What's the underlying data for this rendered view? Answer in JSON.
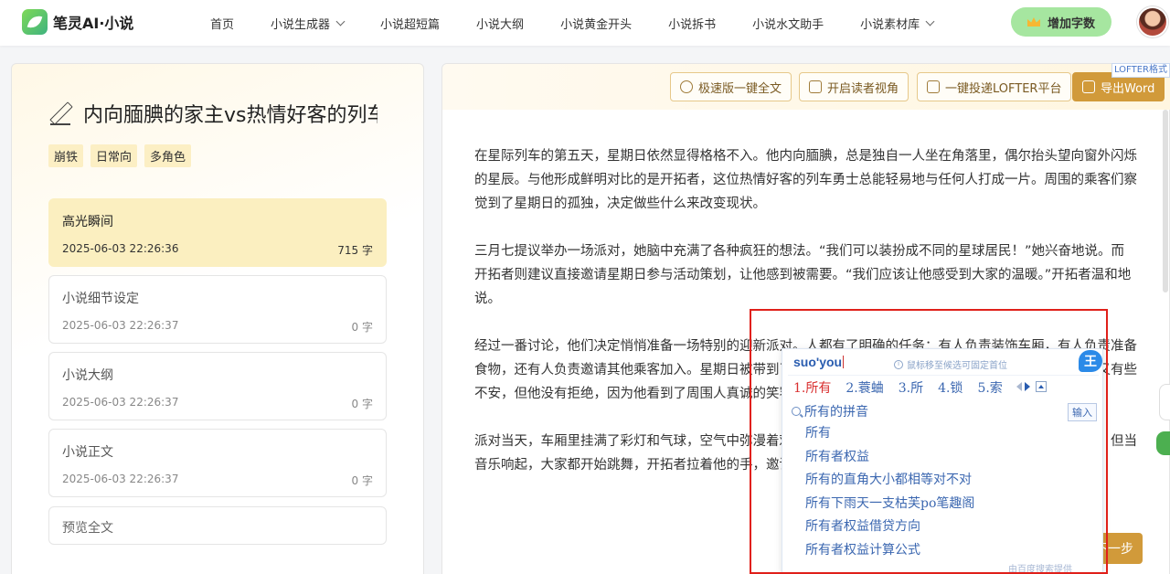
{
  "header": {
    "logo_text": "笔灵AI·小说",
    "nav": [
      {
        "label": "首页",
        "has_dropdown": false
      },
      {
        "label": "小说生成器",
        "has_dropdown": true
      },
      {
        "label": "小说超短篇",
        "has_dropdown": false
      },
      {
        "label": "小说大纲",
        "has_dropdown": false
      },
      {
        "label": "小说黄金开头",
        "has_dropdown": false
      },
      {
        "label": "小说拆书",
        "has_dropdown": false
      },
      {
        "label": "小说水文助手",
        "has_dropdown": false
      },
      {
        "label": "小说素材库",
        "has_dropdown": true
      }
    ],
    "add_words_label": "增加字数"
  },
  "left": {
    "title": "内向腼腆的家主vs热情好客的列车",
    "tags": [
      "崩铁",
      "日常向",
      "多角色"
    ],
    "cards": [
      {
        "title": "高光瞬间",
        "time": "2025-06-03 22:26:36",
        "count": "715 字",
        "active": true
      },
      {
        "title": "小说细节设定",
        "time": "2025-06-03 22:26:37",
        "count": "0 字",
        "active": false
      },
      {
        "title": "小说大纲",
        "time": "2025-06-03 22:26:37",
        "count": "0 字",
        "active": false
      },
      {
        "title": "小说正文",
        "time": "2025-06-03 22:26:37",
        "count": "0 字",
        "active": false
      }
    ],
    "preview_label": "预览全文"
  },
  "toolbar": {
    "fast_full": "极速版一键全文",
    "reader_view": "开启读者视角",
    "lofter": "一键投递LOFTER平台",
    "export_word": "导出Word",
    "lofter_badge": "LOFTER格式"
  },
  "story": {
    "paragraphs": [
      "在星际列车的第五天，星期日依然显得格格不入。他内向腼腆，总是独自一人坐在角落里，偶尔抬头望向窗外闪烁的星辰。与他形成鲜明对比的是开拓者，这位热情好客的列车勇士总能轻易地与任何人打成一片。周围的乘客们察觉到了星期日的孤独，决定做些什么来改变现状。",
      "三月七提议举办一场派对，她脑中充满了各种疯狂的想法。“我们可以装扮成不同的星球居民！”她兴奋地说。而开拓者则建议直接邀请星期日参与活动策划，让他感到被需要。“我们应该让他感受到大家的温暖。”开拓者温和地说。",
      "经过一番讨论，他们决定悄悄准备一场特别的迎新派对。人都有了明确的任务：有人负责装饰车厢，有人负责准备食物，还有人负责邀请其他乘客加入。星期日被带到了车厢中央，看到大家为他精心准备的一切，他既陌生又有些不安，但他没有拒绝，因为他看到了周围人真诚的笑容。",
      "派对当天，车厢里挂满了彩灯和气球，空气中弥漫着欢快的气息。星期日站在人群之中，脸上带着一丝紧张。但当音乐响起，大家都开始跳舞，开拓者拉着他的手，邀请他一起加入欢乐的人群，一起开拓"
    ]
  },
  "ime": {
    "pinyin": "suo'you",
    "hint": "鼠标移至候选可固定首位",
    "candidates": [
      "1.所有",
      "2.蓑蛐",
      "3.所",
      "4.锁",
      "5.索"
    ],
    "search_label": "所有的拼音",
    "input_button": "输入",
    "suggestions": [
      "所有",
      "所有者权益",
      "所有的直角大小都相等对不对",
      "所有下雨天一支枯芙po笔趣阁",
      "所有者权益借贷方向",
      "所有者权益计算公式"
    ],
    "provider": "由百度搜索提供",
    "avatar_char": "王"
  },
  "next_button": "下一步",
  "colors": {
    "accent": "#d19a3a",
    "highlight": "#e0201a",
    "ime_blue": "#3b67b0"
  }
}
